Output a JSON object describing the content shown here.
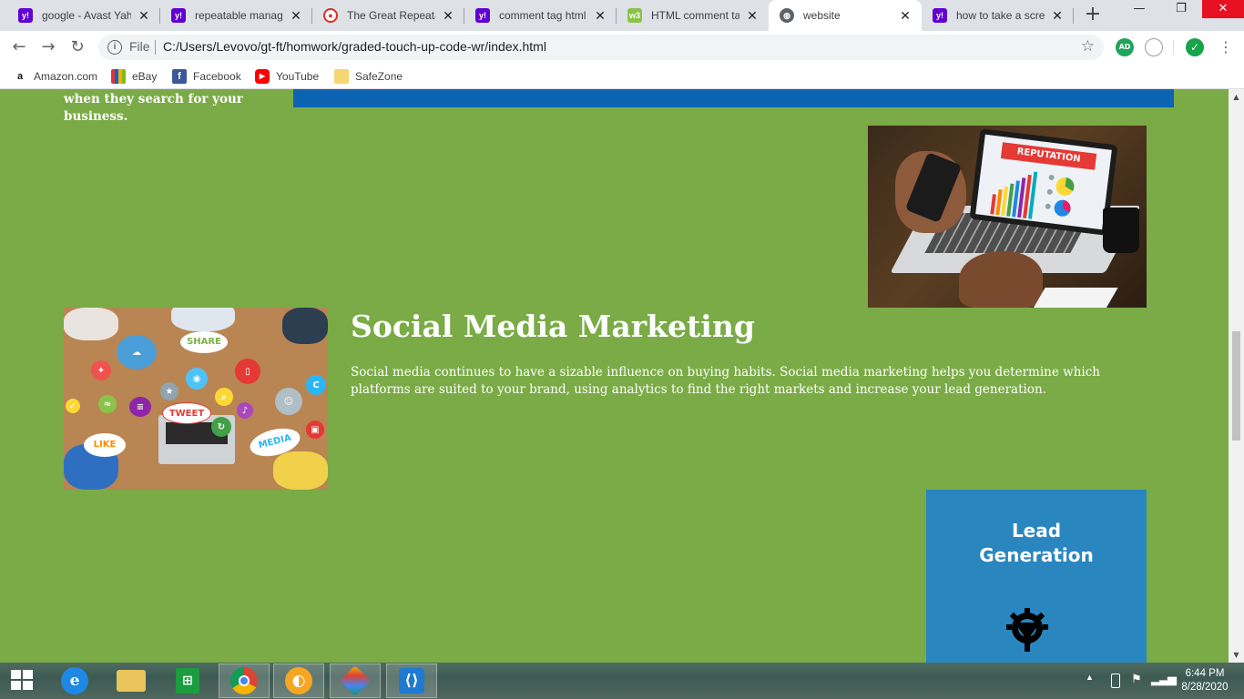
{
  "browser": {
    "tabs": [
      {
        "title": "google - Avast Yah",
        "icon": "yahoo-icon",
        "active": false
      },
      {
        "title": "repeatable manage",
        "icon": "yahoo-icon",
        "active": false
      },
      {
        "title": "The Great Repeatab",
        "icon": "target-icon",
        "active": false
      },
      {
        "title": "comment tag html",
        "icon": "yahoo-icon",
        "active": false
      },
      {
        "title": "HTML comment tag",
        "icon": "w3schools-icon",
        "active": false
      },
      {
        "title": "website",
        "icon": "globe-icon",
        "active": true
      },
      {
        "title": "how to take a scree",
        "icon": "yahoo-icon",
        "active": false
      }
    ],
    "new_tab_label": "+",
    "address": {
      "scheme": "File",
      "url": "C:/Users/Levovo/gt-ft/homwork/graded-touch-up-code-wr/index.html"
    },
    "extensions": [
      {
        "name": "adblock-extension-icon",
        "label": "AD",
        "color": "#20a35a"
      },
      {
        "name": "vpn-extension-icon",
        "label": "",
        "color": "#9aa0a6"
      },
      {
        "name": "avast-shield-extension-icon",
        "label": "✓",
        "color": "#17a34a"
      }
    ],
    "bookmarks": [
      {
        "label": "Amazon.com",
        "icon": "amazon-icon"
      },
      {
        "label": "eBay",
        "icon": "ebay-icon"
      },
      {
        "label": "Facebook",
        "icon": "facebook-icon"
      },
      {
        "label": "YouTube",
        "icon": "youtube-icon"
      },
      {
        "label": "SafeZone",
        "icon": "folder-icon"
      }
    ]
  },
  "page": {
    "cut_text": "when they search for your business.",
    "reputation_image": {
      "banner": "REPUTATION"
    },
    "social_image": {
      "share": "SHARE",
      "tweet": "TWEET",
      "like": "LIKE",
      "media": "MEDIA"
    },
    "section": {
      "heading": "Social Media Marketing",
      "body": "Social media continues to have a sizable influence on buying habits. Social media marketing helps you determine which platforms are suited to your brand, using analytics to find the right markets and increase your lead generation."
    },
    "card": {
      "title_line1": "Lead",
      "title_line2": "Generation"
    },
    "colors": {
      "page_bg": "#7aab46",
      "blue_bar": "#0b63b2",
      "card_bg": "#2a86bf"
    }
  },
  "taskbar": {
    "apps": [
      {
        "name": "internet-explorer",
        "open": false
      },
      {
        "name": "file-explorer",
        "open": false
      },
      {
        "name": "windows-store",
        "open": false
      },
      {
        "name": "chrome",
        "open": true
      },
      {
        "name": "avast-secure-browser",
        "open": true
      },
      {
        "name": "cloud-app",
        "open": true
      },
      {
        "name": "vscode",
        "open": true
      }
    ],
    "clock": {
      "time": "6:44 PM",
      "date": "8/28/2020"
    }
  }
}
